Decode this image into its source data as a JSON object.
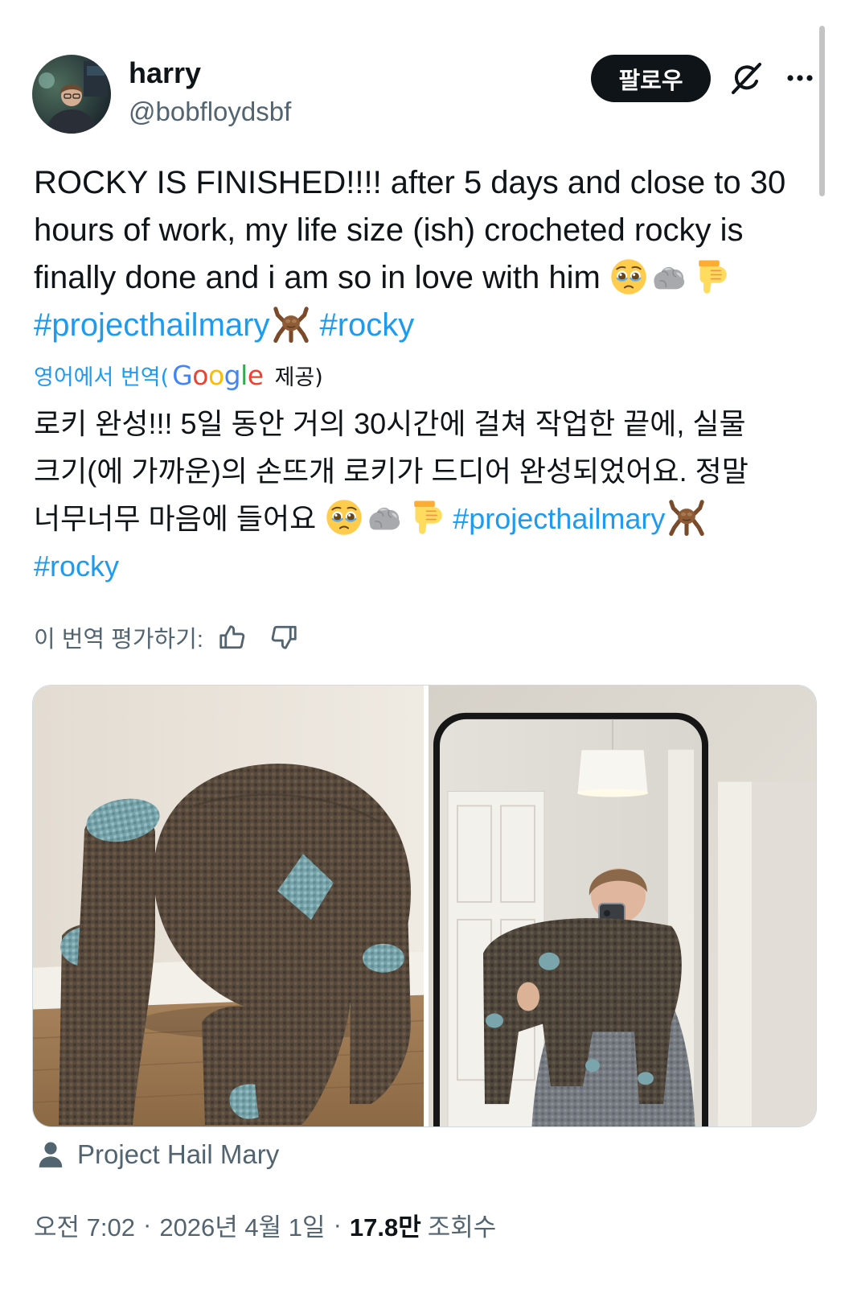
{
  "author": {
    "name": "harry",
    "handle": "@bobfloydsbf"
  },
  "header": {
    "follow_label": "팔로우",
    "icons": [
      "grok-icon",
      "more-icon"
    ]
  },
  "tweet": {
    "line1": "ROCKY IS FINISHED!!!! after 5 days and close to 30",
    "line2": "hours of work, my life size (ish) crocheted rocky is",
    "line3": "finally done and i am so in love with him",
    "line3_emojis": [
      "face-holding-back-tears-emoji",
      "rock-emoji",
      "thumbs-down-emoji"
    ],
    "hashtag_project": "#projecthailmary",
    "hashtag_emoji": "rocky-emoji",
    "hashtag_rocky": "#rocky"
  },
  "translation": {
    "label_prefix": "영어에서 번역(",
    "google_letters": [
      "G",
      "o",
      "o",
      "g",
      "l",
      "e"
    ],
    "google_colors": [
      "#4285F4",
      "#EA4335",
      "#FBBC05",
      "#4285F4",
      "#34A853",
      "#EA4335"
    ],
    "label_suffix": "제공)"
  },
  "translated": {
    "line1": "로키 완성!!! 5일 동안 거의 30시간에 걸쳐 작업한 끝에, 실물",
    "line2": "크기(에 가까운)의 손뜨개 로키가 드디어 완성되었어요. 정말",
    "line3": "너무너무 마음에 들어요",
    "hashtag_project": "#projecthailmary",
    "hashtag_rocky": "#rocky"
  },
  "rating": {
    "label": "이 번역 평가하기:",
    "icons": [
      "thumbs-up-icon",
      "thumbs-down-icon"
    ]
  },
  "location": {
    "icon": "person-icon",
    "name": "Project Hail Mary"
  },
  "meta": {
    "time": "오전 7:02",
    "separator": "·",
    "date": "2026년 4월 1일",
    "views_count": "17.8만",
    "views_label": "조회수"
  },
  "colors": {
    "text": "#0f1419",
    "secondary": "#536471",
    "link": "#1d9bf0",
    "follow_bg": "#0f1419"
  }
}
